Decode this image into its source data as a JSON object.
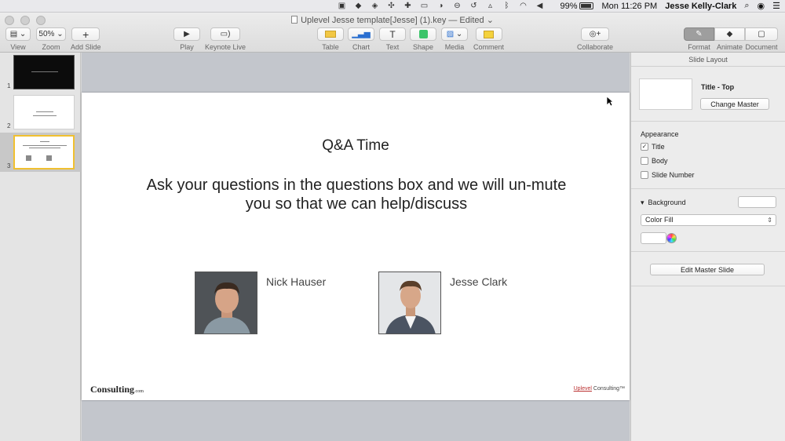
{
  "menubar": {
    "battery_text": "99%",
    "clock": "Mon 11:26 PM",
    "user": "Jesse Kelly-Clark"
  },
  "window": {
    "title": "Uplevel Jesse template[Jesse] (1).key — Edited"
  },
  "toolbar": {
    "view_label": "View",
    "zoom_value": "50%",
    "zoom_label": "Zoom",
    "add_slide_label": "Add Slide",
    "play_label": "Play",
    "keynote_live_label": "Keynote Live",
    "table_label": "Table",
    "chart_label": "Chart",
    "text_label": "Text",
    "shape_label": "Shape",
    "media_label": "Media",
    "comment_label": "Comment",
    "collaborate_label": "Collaborate",
    "format_label": "Format",
    "animate_label": "Animate",
    "document_label": "Document"
  },
  "navigator": {
    "slides": [
      {
        "num": "1"
      },
      {
        "num": "2"
      },
      {
        "num": "3"
      }
    ]
  },
  "slide": {
    "title": "Q&A Time",
    "body": "Ask your questions in the questions box and we will un-mute you so that we can help/discuss",
    "people": [
      {
        "name": "Nick Hauser"
      },
      {
        "name": "Jesse Clark"
      }
    ],
    "footer_left": "Consulting",
    "footer_left_suffix": ".com",
    "footer_right_brand": "Uplevel",
    "footer_right_rest": " Consulting™"
  },
  "inspector": {
    "header": "Slide Layout",
    "master_name": "Title - Top",
    "change_master": "Change Master",
    "appearance_label": "Appearance",
    "checkboxes": [
      {
        "label": "Title",
        "checked": true
      },
      {
        "label": "Body",
        "checked": false
      },
      {
        "label": "Slide Number",
        "checked": false
      }
    ],
    "background_label": "Background",
    "fill_type": "Color Fill",
    "edit_master": "Edit Master Slide"
  },
  "colors": {
    "canvas_bg": "#c3c6cc",
    "selected_thumb_border": "#f0c030",
    "brand_red": "#b33333"
  }
}
